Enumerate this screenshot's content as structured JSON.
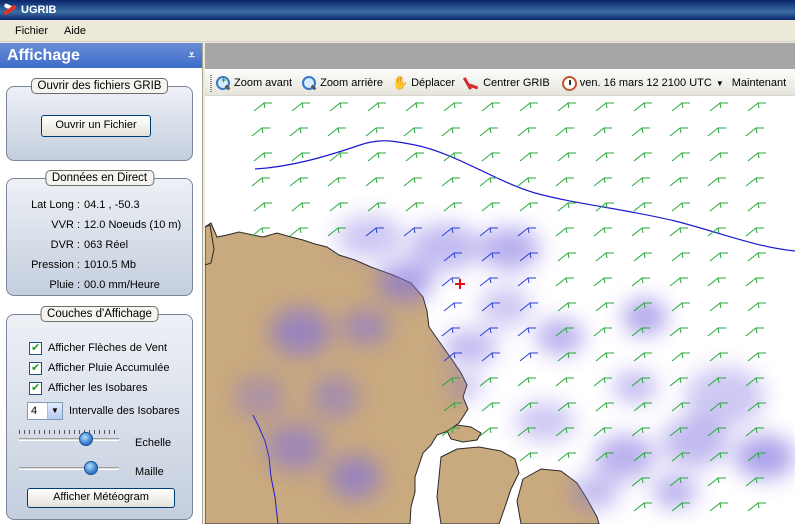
{
  "window": {
    "title": "UGRIB"
  },
  "menu": {
    "items": [
      "Fichier",
      "Aide"
    ]
  },
  "side": {
    "title": "Affichage",
    "open_group": {
      "title": "Ouvrir des fichiers GRIB",
      "button": "Ouvrir un Fichier"
    },
    "live_group": {
      "title": "Données en Direct",
      "rows": [
        {
          "label": "Lat Long :",
          "value": "04.1 ,  -50.3"
        },
        {
          "label": "VVR :",
          "value": "12.0 Noeuds (10 m)"
        },
        {
          "label": "DVR :",
          "value": "063 Réel"
        },
        {
          "label": "Pression :",
          "value": "1010.5 Mb"
        },
        {
          "label": "Pluie :",
          "value": "00.0 mm/Heure"
        }
      ]
    },
    "layers_group": {
      "title": "Couches d'Affichage",
      "checkboxes": [
        {
          "label": "Afficher Flèches de Vent",
          "checked": true
        },
        {
          "label": "Afficher Pluie Accumulée",
          "checked": true
        },
        {
          "label": "Afficher les Isobares",
          "checked": true
        }
      ],
      "isobar_select": {
        "value": "4",
        "label": "Intervalle des Isobares"
      },
      "scale_slider": {
        "label": "Echelle",
        "value": 0.67
      },
      "grid_slider": {
        "label": "Maille",
        "value": 0.72
      },
      "meteogram_button": "Afficher Météogram"
    }
  },
  "toolbar": {
    "zoom_in": "Zoom avant",
    "zoom_out": "Zoom arrière",
    "pan": "Déplacer",
    "center": "Centrer GRIB",
    "datetime": "ven. 16 mars 12 2100 UTC",
    "now": "Maintenant"
  },
  "map": {
    "colors": {
      "land": "#c9a97e",
      "coast": "#2a2a2a",
      "isobar": "#1a1ad0",
      "wind": "#27a83a",
      "wind_over_rain": "#2c3fd4",
      "rain": "#7e6fe0",
      "marker": "#e01010"
    }
  }
}
